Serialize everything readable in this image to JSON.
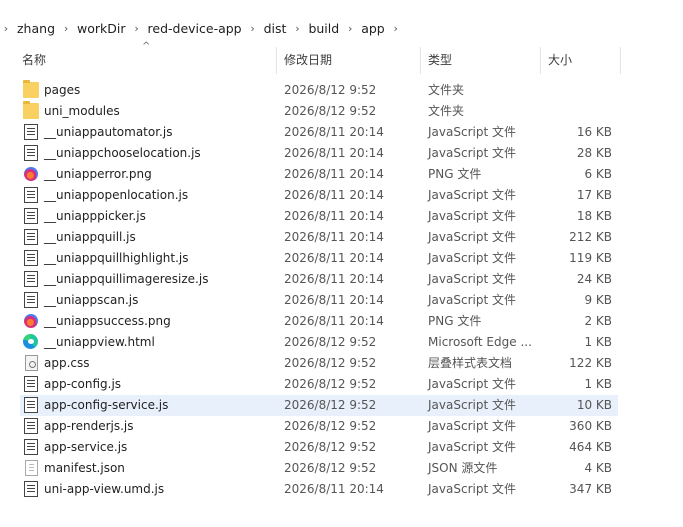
{
  "breadcrumb": [
    "zhang",
    "workDir",
    "red-device-app",
    "dist",
    "build",
    "app"
  ],
  "columns": {
    "name": "名称",
    "date": "修改日期",
    "type": "类型",
    "size": "大小"
  },
  "files": [
    {
      "name": "pages",
      "date": "2026/8/12 9:52",
      "type": "文件夹",
      "size": "",
      "icon": "folder-icon"
    },
    {
      "name": "uni_modules",
      "date": "2026/8/12 9:52",
      "type": "文件夹",
      "size": "",
      "icon": "folder-icon"
    },
    {
      "name": "__uniappautomator.js",
      "date": "2026/8/11 20:14",
      "type": "JavaScript 文件",
      "size": "16 KB",
      "icon": "javascript-file-icon"
    },
    {
      "name": "__uniappchooselocation.js",
      "date": "2026/8/11 20:14",
      "type": "JavaScript 文件",
      "size": "28 KB",
      "icon": "javascript-file-icon"
    },
    {
      "name": "__uniapperror.png",
      "date": "2026/8/11 20:14",
      "type": "PNG 文件",
      "size": "6 KB",
      "icon": "png-file-icon"
    },
    {
      "name": "__uniappopenlocation.js",
      "date": "2026/8/11 20:14",
      "type": "JavaScript 文件",
      "size": "17 KB",
      "icon": "javascript-file-icon"
    },
    {
      "name": "__uniapppicker.js",
      "date": "2026/8/11 20:14",
      "type": "JavaScript 文件",
      "size": "18 KB",
      "icon": "javascript-file-icon"
    },
    {
      "name": "__uniappquill.js",
      "date": "2026/8/11 20:14",
      "type": "JavaScript 文件",
      "size": "212 KB",
      "icon": "javascript-file-icon"
    },
    {
      "name": "__uniappquillhighlight.js",
      "date": "2026/8/11 20:14",
      "type": "JavaScript 文件",
      "size": "119 KB",
      "icon": "javascript-file-icon"
    },
    {
      "name": "__uniappquillimageresize.js",
      "date": "2026/8/11 20:14",
      "type": "JavaScript 文件",
      "size": "24 KB",
      "icon": "javascript-file-icon"
    },
    {
      "name": "__uniappscan.js",
      "date": "2026/8/11 20:14",
      "type": "JavaScript 文件",
      "size": "9 KB",
      "icon": "javascript-file-icon"
    },
    {
      "name": "__uniappsuccess.png",
      "date": "2026/8/11 20:14",
      "type": "PNG 文件",
      "size": "2 KB",
      "icon": "png-file-icon"
    },
    {
      "name": "__uniappview.html",
      "date": "2026/8/12 9:52",
      "type": "Microsoft Edge ...",
      "size": "1 KB",
      "icon": "edge-html-icon"
    },
    {
      "name": "app.css",
      "date": "2026/8/12 9:52",
      "type": "层叠样式表文档",
      "size": "122 KB",
      "icon": "css-file-icon"
    },
    {
      "name": "app-config.js",
      "date": "2026/8/12 9:52",
      "type": "JavaScript 文件",
      "size": "1 KB",
      "icon": "javascript-file-icon"
    },
    {
      "name": "app-config-service.js",
      "date": "2026/8/12 9:52",
      "type": "JavaScript 文件",
      "size": "10 KB",
      "icon": "javascript-file-icon",
      "selected": true
    },
    {
      "name": "app-renderjs.js",
      "date": "2026/8/12 9:52",
      "type": "JavaScript 文件",
      "size": "360 KB",
      "icon": "javascript-file-icon"
    },
    {
      "name": "app-service.js",
      "date": "2026/8/12 9:52",
      "type": "JavaScript 文件",
      "size": "464 KB",
      "icon": "javascript-file-icon"
    },
    {
      "name": "manifest.json",
      "date": "2026/8/12 9:52",
      "type": "JSON 源文件",
      "size": "4 KB",
      "icon": "json-file-icon"
    },
    {
      "name": "uni-app-view.umd.js",
      "date": "2026/8/11 20:14",
      "type": "JavaScript 文件",
      "size": "347 KB",
      "icon": "javascript-file-icon"
    }
  ]
}
